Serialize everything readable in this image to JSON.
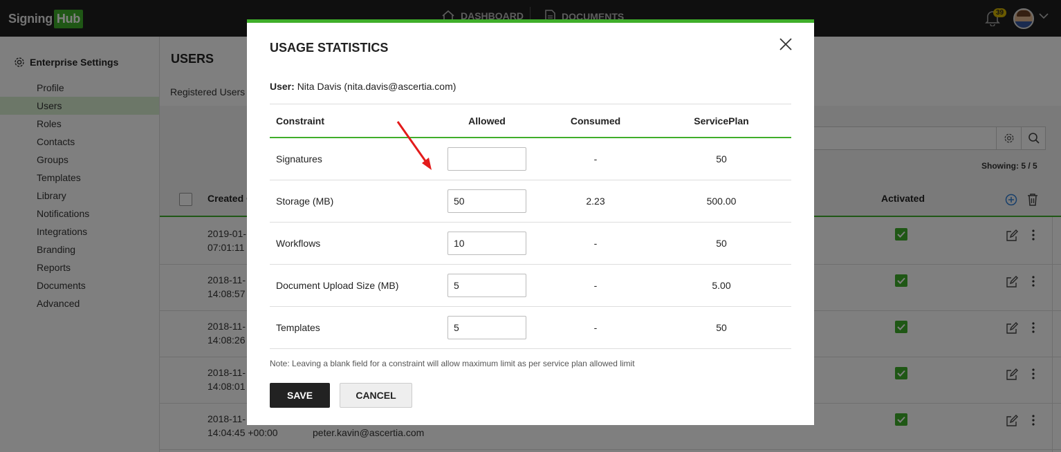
{
  "app": {
    "logo_part1": "Signing",
    "logo_part2": "Hub",
    "nav": [
      "DASHBOARD",
      "DOCUMENTS"
    ],
    "notification_count": "39",
    "accent_color": "#3fae2a"
  },
  "sidebar": {
    "heading": "Enterprise Settings",
    "items": [
      {
        "label": "Profile"
      },
      {
        "label": "Users"
      },
      {
        "label": "Roles"
      },
      {
        "label": "Contacts"
      },
      {
        "label": "Groups"
      },
      {
        "label": "Templates"
      },
      {
        "label": "Library"
      },
      {
        "label": "Notifications"
      },
      {
        "label": "Integrations"
      },
      {
        "label": "Branding"
      },
      {
        "label": "Reports"
      },
      {
        "label": "Documents"
      },
      {
        "label": "Advanced"
      }
    ],
    "active": "Users"
  },
  "main": {
    "title": "USERS",
    "subtitle": "Registered Users",
    "showing": "Showing: 5  /  5",
    "columns": {
      "created": "Created O",
      "activated": "Activated"
    },
    "rows": [
      {
        "date": "2019-01-",
        "time": "07:01:11",
        "email": ""
      },
      {
        "date": "2018-11-",
        "time": "14:08:57",
        "email": ""
      },
      {
        "date": "2018-11-",
        "time": "14:08:26",
        "email": ""
      },
      {
        "date": "2018-11-",
        "time": "14:08:01",
        "email": ""
      },
      {
        "date": "2018-11-",
        "time": "14:04:45 +00:00",
        "email": "peter.kavin@ascertia.com"
      }
    ]
  },
  "modal": {
    "title": "USAGE STATISTICS",
    "user_label": "User:",
    "user_value": "Nita Davis (nita.davis@ascertia.com)",
    "columns": {
      "constraint": "Constraint",
      "allowed": "Allowed",
      "consumed": "Consumed",
      "service_plan": "ServicePlan"
    },
    "rows": [
      {
        "constraint": "Signatures",
        "allowed": "",
        "consumed": "-",
        "service_plan": "50"
      },
      {
        "constraint": "Storage (MB)",
        "allowed": "50",
        "consumed": "2.23",
        "service_plan": "500.00"
      },
      {
        "constraint": "Workflows",
        "allowed": "10",
        "consumed": "-",
        "service_plan": "50"
      },
      {
        "constraint": "Document Upload Size (MB)",
        "allowed": "5",
        "consumed": "-",
        "service_plan": "5.00"
      },
      {
        "constraint": "Templates",
        "allowed": "5",
        "consumed": "-",
        "service_plan": "50"
      }
    ],
    "note": "Note: Leaving a blank field for a constraint will allow maximum limit as per service plan allowed limit",
    "save_label": "SAVE",
    "cancel_label": "CANCEL"
  }
}
